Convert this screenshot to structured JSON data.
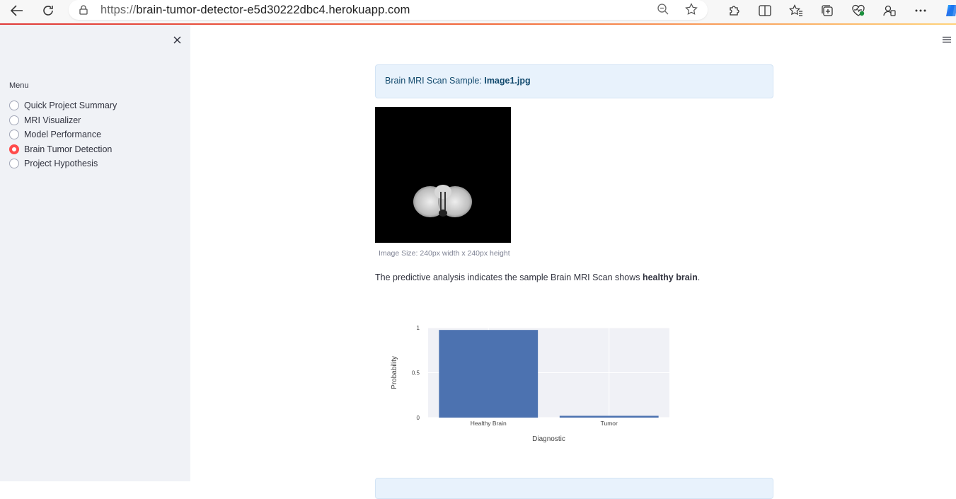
{
  "browser": {
    "url_protocol": "https://",
    "url_host": "brain-tumor-detector-e5d30222dbc4.herokuapp.com",
    "icons": [
      "back-icon",
      "refresh-icon",
      "lock-icon",
      "zoom-out-icon",
      "favorite-star-icon",
      "extensions-icon",
      "split-screen-icon",
      "favorites-icon",
      "collections-icon",
      "browser-essentials-icon",
      "profile-sync-icon",
      "more-icon",
      "copilot-icon"
    ]
  },
  "sidebar": {
    "close_label": "×",
    "menu_label": "Menu",
    "items": [
      {
        "label": "Quick Project Summary",
        "selected": false
      },
      {
        "label": "MRI Visualizer",
        "selected": false
      },
      {
        "label": "Model Performance",
        "selected": false
      },
      {
        "label": "Brain Tumor Detection",
        "selected": true
      },
      {
        "label": "Project Hypothesis",
        "selected": false
      }
    ],
    "accent_color": "#ff4b4b"
  },
  "main": {
    "info_prefix": "Brain MRI Scan Sample: ",
    "info_filename": "Image1.jpg",
    "image_caption": "Image Size: 240px width x 240px height",
    "result_prefix": "The predictive analysis indicates the sample Brain MRI Scan shows ",
    "result_diagnosis": "healthy brain",
    "result_suffix": "."
  },
  "chart_data": {
    "type": "bar",
    "categories": [
      "Healthy Brain",
      "Tumor"
    ],
    "values": [
      0.975,
      0.02
    ],
    "title": "",
    "xlabel": "Diagnostic",
    "ylabel": "Probability",
    "ylim": [
      0,
      1
    ],
    "yticks": [
      0,
      0.5,
      1
    ],
    "ytick_labels": [
      "0",
      "0.5",
      "1"
    ],
    "grid": true,
    "bar_color": "#4c72b0",
    "background_color": "#f0f1f6"
  }
}
